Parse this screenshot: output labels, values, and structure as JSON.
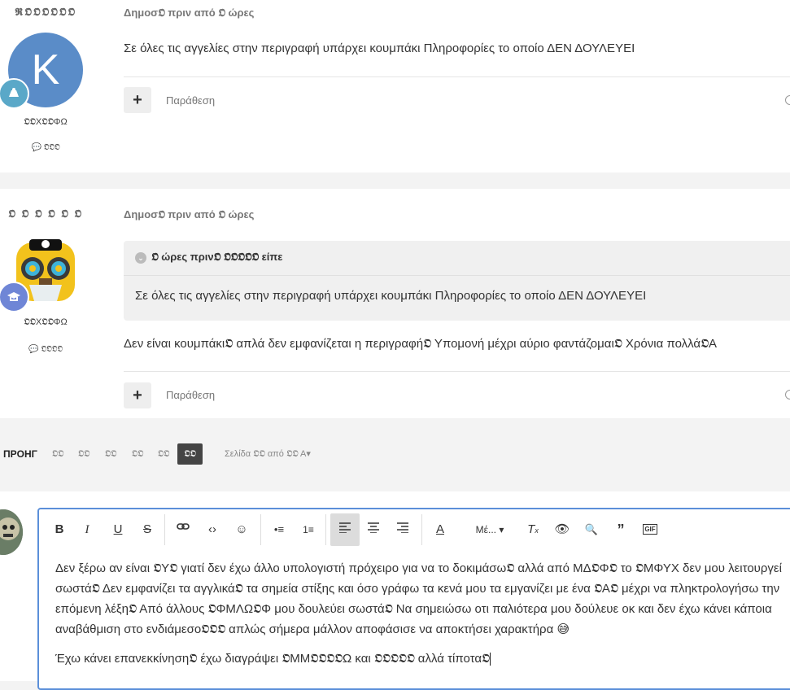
{
  "posts": [
    {
      "author": "𝕽𝕺𝕺𝕺𝕺𝕺𝕺",
      "avatar_letter": "K",
      "group": "𝕺𝕺Χ𝕺𝕺ΦΩ",
      "post_count": "𝕺𝕺𝕺",
      "meta": "Δημοσ𝕺 πριν από 𝕺 ώρες",
      "body": "Σε όλες τις αγγελίες στην περιγραφή υπάρχει κουμπάκι Πληροφορίες το οποίο ΔΕΝ ΔΟΥΛΕΥΕΙ",
      "quote_label": "Παράθεση"
    },
    {
      "author": "𝕺 𝕺 𝕺 𝕺 𝕺 𝕺",
      "group": "𝕺𝕺Χ𝕺𝕺ΦΩ",
      "post_count": "𝕺𝕺𝕺𝕺",
      "meta": "Δημοσ𝕺 πριν από 𝕺 ώρες",
      "quote_head": "𝕺 ώρες πριν𝕺 𝕺𝕺𝕺𝕺𝕺 είπε",
      "quote_text": "Σε όλες τις αγγελίες στην περιγραφή υπάρχει κουμπάκι Πληροφορίες το οποίο ΔΕΝ ΔΟΥΛΕΥΕΙ",
      "body": "Δεν είναι κουμπάκι𝕺 απλά δεν εμφανίζεται η περιγραφή𝕺 Υπομονή μέχρι αύριο φαντάζομαι𝕺 Χρόνια πολλά𝕺Α",
      "quote_label": "Παράθεση"
    }
  ],
  "pagination": {
    "prev": "ΠΡΟΗΓ",
    "pages": [
      "𝕺𝕺",
      "𝕺𝕺",
      "𝕺𝕺",
      "𝕺𝕺",
      "𝕺𝕺",
      "𝕺𝕺"
    ],
    "page_info": "Σελίδα 𝕺𝕺 από 𝕺𝕺 Α▾"
  },
  "editor": {
    "font_size_label": "Μέ...",
    "paragraph1": "Δεν ξέρω αν είναι 𝕺Υ𝕺 γιατί δεν έχω άλλο υπολογιστή πρόχειρο για να το δοκιμάσω𝕺 αλλά από ΜΔ𝕺Φ𝕺 το 𝕺ΜΦΥΧ δεν μου λειτουργεί σωστά𝕺 Δεν εμφανίζει τα αγγλικά𝕺 τα σημεία στίξης και όσο γράφω τα κενά μου τα εμγανίζει με ένα 𝕺Α𝕺 μέχρι να πληκτρολογήσω την επόμενη λέξη𝕺 Από άλλους 𝕺ΦΜΛΩ𝕺Φ μου δουλεύει σωστά𝕺 Να σημειώσω οτι παλιότερα μου δούλευε οκ και δεν έχω κάνει κάποια αναβάθμιση στο ενδιάμεσο𝕺𝕺𝕺 απλώς σήμερα μάλλον αποφάσισε να αποκτήσει χαρακτήρα",
    "emoji": "😅",
    "paragraph2": "Έχω κάνει επανεκκίνηση𝕺 έχω διαγράψει 𝕺ΜΜ𝕺𝕺𝕺𝕺Ω και 𝕺𝕺𝕺𝕺𝕺 αλλά τίποτα𝕺"
  },
  "colors": {
    "avatar_k": "#5a8cc8",
    "editor_border": "#5b8fd9",
    "active_page": "#444444"
  }
}
